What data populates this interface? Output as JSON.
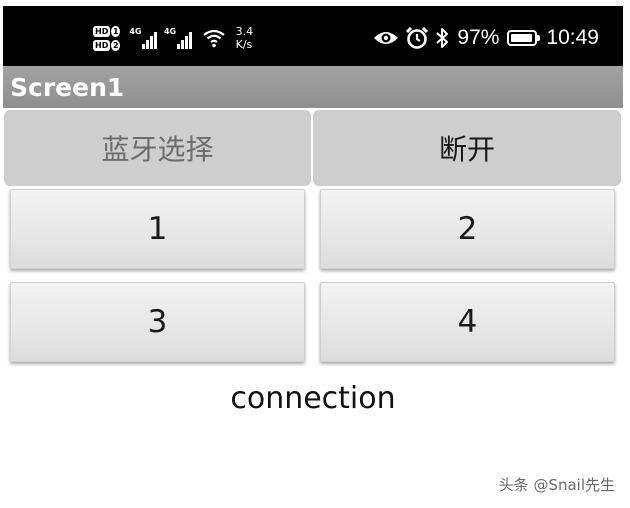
{
  "status_bar": {
    "hd1": "HD",
    "hd1_slot": "1",
    "hd2": "HD",
    "hd2_slot": "2",
    "net_type_1": "4G",
    "net_type_2": "4G",
    "speed_value": "3.4",
    "speed_unit": "K/s",
    "battery_percent": "97%",
    "battery_level": 0.97,
    "time": "10:49",
    "icons": [
      "eye-icon",
      "alarm-icon",
      "bluetooth-icon",
      "battery-icon",
      "wifi-icon",
      "signal-icon"
    ]
  },
  "app": {
    "title": "Screen1"
  },
  "buttons": {
    "bluetooth_select": "蓝牙选择",
    "disconnect": "断开",
    "btn1": "1",
    "btn2": "2",
    "btn3": "3",
    "btn4": "4"
  },
  "status_label": "connection",
  "watermark": "头条 @Snail先生",
  "colors": {
    "status_bar_bg": "#000000",
    "title_bar_bg": "#999999",
    "top_button_bg": "#cecece",
    "bluetooth_text": "#6c6c6c",
    "num_button_bg": "#e8e8e8",
    "page_bg": "#ffffff"
  }
}
